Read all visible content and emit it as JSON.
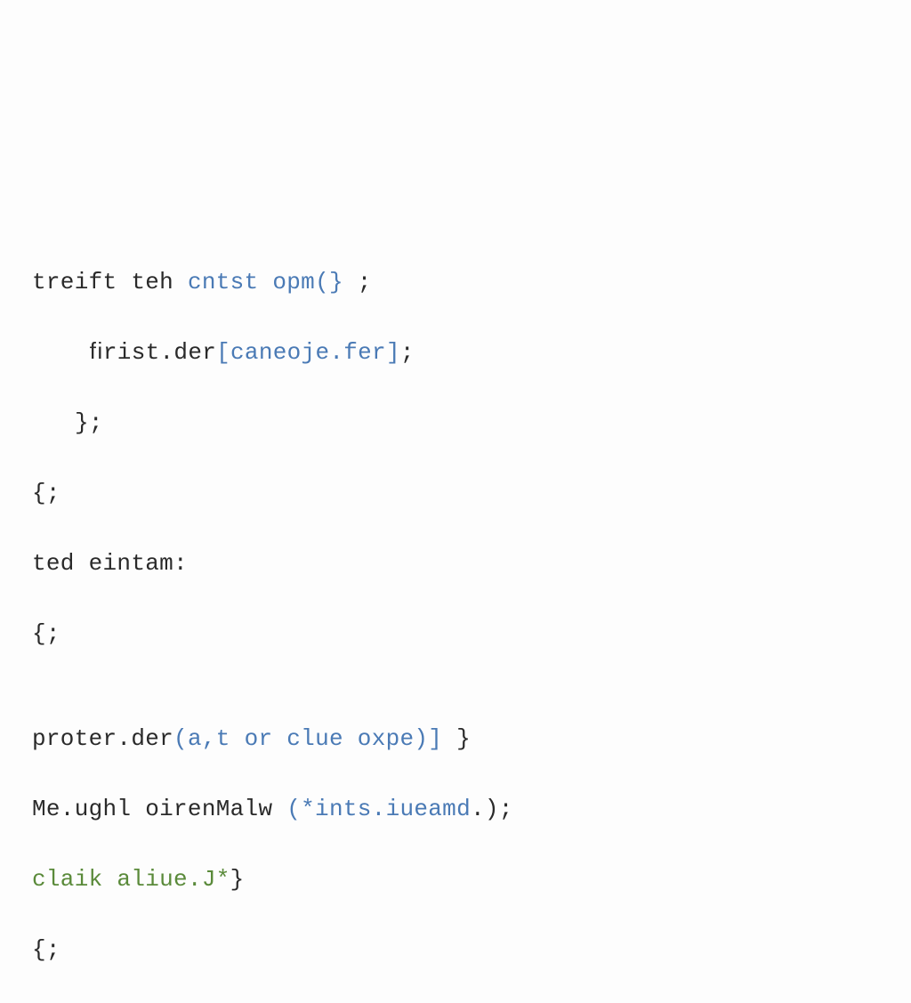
{
  "code": {
    "line1": {
      "t1": "treift teh ",
      "t2": "cntst",
      "t3": " opm",
      "t4": "(}",
      "t5": " ;"
    },
    "line2": {
      "t1": "ﬁrist.der",
      "t2": "[",
      "t3": "caneoje.fer",
      "t4": "]",
      "t5": ";"
    },
    "line3": {
      "t1": "};"
    },
    "line4": {
      "t1": "{;"
    },
    "line5": {
      "t1": "ted eintam:"
    },
    "line6": {
      "t1": "{;"
    },
    "line7": {
      "t1": ""
    },
    "line8": {
      "t1": "proter.der",
      "t2": "(",
      "t3": "a,",
      "t4": "t ",
      "t5": "or",
      "t6": " clue oxpe",
      "t7": ")]",
      "t8": " }"
    },
    "line9": {
      "t1": "Me.ughl oirenMalw ",
      "t2": "(",
      "t3": "*ints.iueamd",
      "t4": ".);"
    },
    "line10": {
      "t1": "claik aliue.J*",
      "t2": "}"
    },
    "line11": {
      "t1": "{;"
    }
  }
}
